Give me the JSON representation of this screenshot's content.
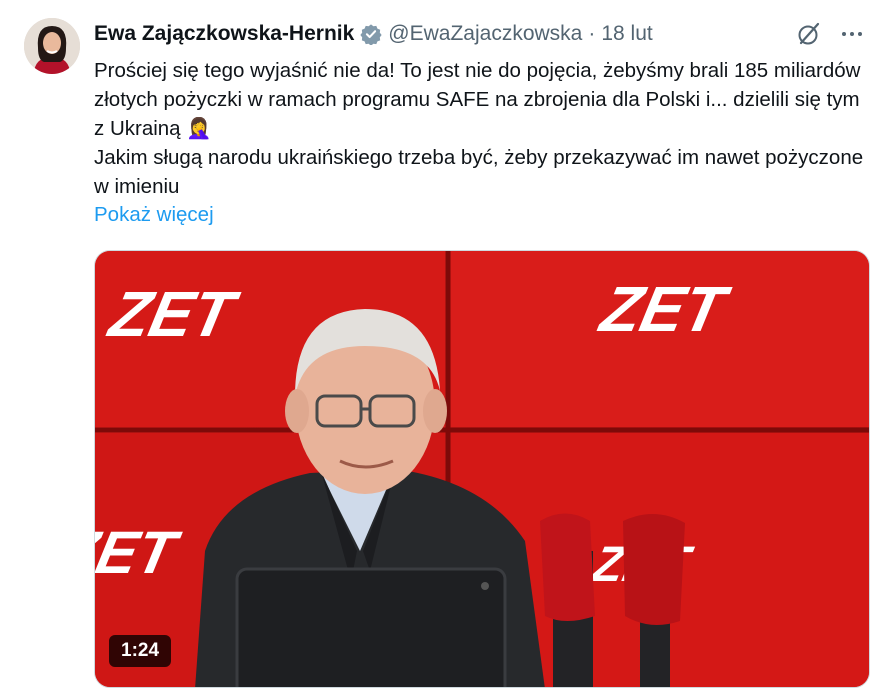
{
  "author": {
    "name": "Ewa Zajączkowska-Hernik",
    "handle": "@EwaZajaczkowska",
    "separator": "·",
    "date": "18 lut"
  },
  "tweet": {
    "paragraphs": [
      "Prościej się tego wyjaśnić nie da! To jest nie do pojęcia, żebyśmy brali 185 miliardów złotych pożyczki w ramach programu SAFE na zbrojenia dla Polski i... dzielili się tym z Ukrainą",
      "Jakim sługą narodu ukraińskiego trzeba być, żeby przekazywać im nawet pożyczone w imieniu"
    ],
    "emoji": "🤦‍♀️",
    "show_more": "Pokaż więcej"
  },
  "media": {
    "logo_text": "ZET",
    "duration": "1:24"
  },
  "colors": {
    "accent": "#1d9bf0",
    "studio_red": "#d81a1a",
    "verified": "#829aab"
  },
  "icons": [
    "verified-badge-icon",
    "grok-icon",
    "more-icon"
  ]
}
